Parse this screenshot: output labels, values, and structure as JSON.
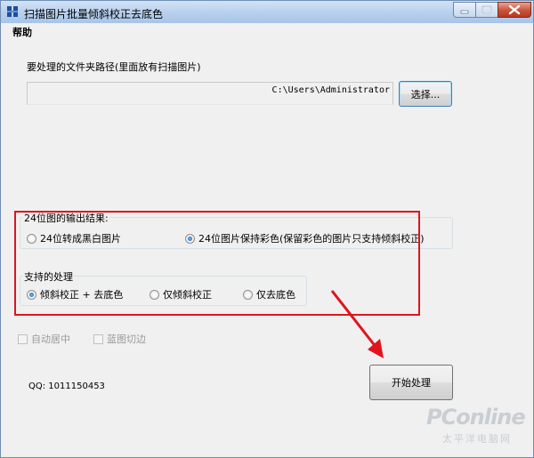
{
  "window": {
    "title": "扫描图片批量倾斜校正去底色",
    "controls": {
      "minimize": "minimize",
      "maximize": "maximize",
      "close": "close"
    }
  },
  "menu": {
    "items": [
      {
        "label": "帮助"
      }
    ]
  },
  "folder": {
    "label": "要处理的文件夹路径(里面放有扫描图片)",
    "path": "C:\\Users\\Administrator",
    "browse_label": "选择..."
  },
  "output_group": {
    "title": "24位图的输出结果:",
    "options": [
      {
        "label": "24位转成黑白图片",
        "selected": false
      },
      {
        "label": "24位图片保持彩色(保留彩色的图片只支持倾斜校正)",
        "selected": true
      }
    ]
  },
  "processing_group": {
    "title": "支持的处理",
    "options": [
      {
        "label": "倾斜校正 + 去底色",
        "selected": true
      },
      {
        "label": "仅倾斜校正",
        "selected": false
      },
      {
        "label": "仅去底色",
        "selected": false
      }
    ]
  },
  "checkboxes": [
    {
      "label": "自动居中",
      "checked": false,
      "enabled": false
    },
    {
      "label": "蓝图切边",
      "checked": false,
      "enabled": false
    }
  ],
  "contact": {
    "qq": "QQ: 1011150453"
  },
  "start_label": "开始处理",
  "watermark": {
    "main": "PConline",
    "sub": "太平洋电脑网"
  },
  "colors": {
    "highlight": "#e0141c",
    "titlebar": "#b9d1ee",
    "close_button": "#c7523a"
  }
}
